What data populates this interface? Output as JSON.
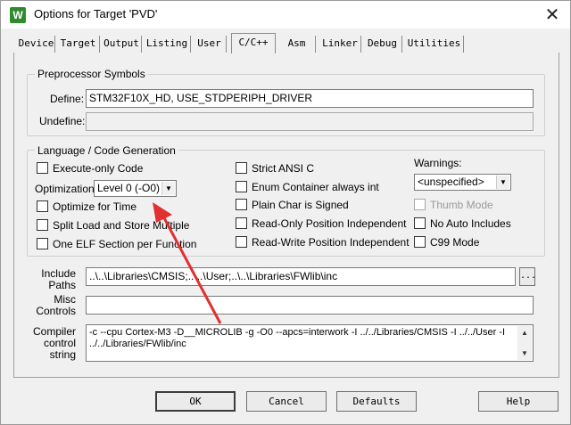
{
  "window": {
    "title": "Options for Target 'PVD'",
    "icon_letter": "W",
    "close_glyph": "✕"
  },
  "tabs": [
    "Device",
    "Target",
    "Output",
    "Listing",
    "User",
    "C/C++",
    "Asm",
    "Linker",
    "Debug",
    "Utilities"
  ],
  "active_tab": "C/C++",
  "preprocessor": {
    "group_label": "Preprocessor Symbols",
    "define_label": "Define:",
    "define_value": "STM32F10X_HD, USE_STDPERIPH_DRIVER",
    "undefine_label": "Undefine:",
    "undefine_value": ""
  },
  "language": {
    "group_label": "Language / Code Generation",
    "execute_only": "Execute-only Code",
    "optimization_label": "Optimization:",
    "optimization_value": "Level 0 (-O0)",
    "optimize_time": "Optimize for Time",
    "split_load": "Split Load and Store Multiple",
    "one_elf": "One ELF Section per Function",
    "strict_ansi": "Strict ANSI C",
    "enum_container": "Enum Container always int",
    "plain_char": "Plain Char is Signed",
    "ro_pos": "Read-Only Position Independent",
    "rw_pos": "Read-Write Position Independent",
    "warnings_label": "Warnings:",
    "warnings_value": "<unspecified>",
    "thumb_mode": "Thumb Mode",
    "no_auto_includes": "No Auto Includes",
    "c99_mode": "C99 Mode"
  },
  "include": {
    "label": "Include\nPaths",
    "label_line1": "Include",
    "label_line2": "Paths",
    "value": "..\\..\\Libraries\\CMSIS;..\\..\\User;..\\..\\Libraries\\FWlib\\inc",
    "browse": "..."
  },
  "misc": {
    "label_line1": "Misc",
    "label_line2": "Controls",
    "value": ""
  },
  "compiler": {
    "label_line1": "Compiler",
    "label_line2": "control",
    "label_line3": "string",
    "value": "-c --cpu Cortex-M3 -D__MICROLIB -g -O0 --apcs=interwork -I ../../Libraries/CMSIS -I ../../User -I ../../Libraries/FWlib/inc"
  },
  "buttons": {
    "ok": "OK",
    "cancel": "Cancel",
    "defaults": "Defaults",
    "help": "Help"
  },
  "colors": {
    "annotation_arrow": "#e03030",
    "background": "#f0f0f0"
  }
}
